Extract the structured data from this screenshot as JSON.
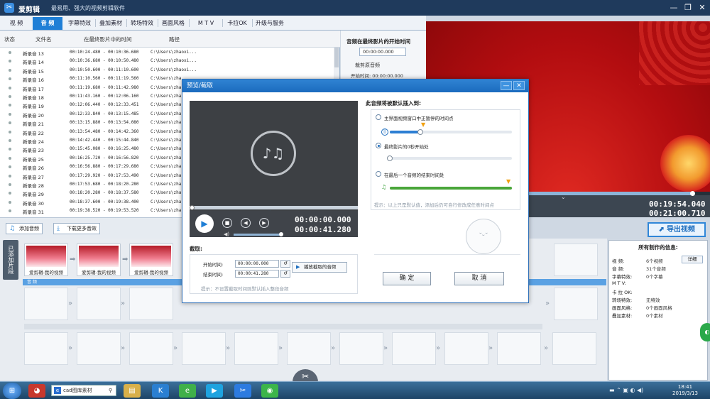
{
  "app": {
    "name": "爱剪辑",
    "slogan": "最易用、强大的视频剪辑软件"
  },
  "window": {
    "minimize": "—",
    "restore": "❐",
    "close": "✕"
  },
  "menu": [
    "视 频",
    "音 频",
    "字幕特效",
    "叠加素材",
    "转场特效",
    "画面风格",
    "M T V",
    "卡拉OK",
    "升级与服务"
  ],
  "table": {
    "headers": [
      "状态",
      "文件名",
      "在最终影片中的时间",
      "路径"
    ],
    "rows": [
      {
        "name": "新录音 13",
        "time": "00:10:24.480 - 00:10:36.680",
        "path": "C:\\Users\\zhaoxi..."
      },
      {
        "name": "新录音 14",
        "time": "00:10:36.680 - 00:10:50.480",
        "path": "C:\\Users\\zhaoxi..."
      },
      {
        "name": "新录音 15",
        "time": "00:10:50.600 - 00:11:10.600",
        "path": "C:\\Users\\zhaoxi..."
      },
      {
        "name": "新录音 16",
        "time": "00:11:10.560 - 00:11:19.560",
        "path": "C:\\Users\\zha"
      },
      {
        "name": "新录音 17",
        "time": "00:11:19.680 - 00:11:42.980",
        "path": "C:\\Users\\zha"
      },
      {
        "name": "新录音 18",
        "time": "00:11:43.160 - 00:12:06.160",
        "path": "C:\\Users\\zha"
      },
      {
        "name": "新录音 19",
        "time": "00:12:06.440 - 00:12:33.451",
        "path": "C:\\Users\\zha"
      },
      {
        "name": "新录音 20",
        "time": "00:12:33.840 - 00:13:15.485",
        "path": "C:\\Users\\zha"
      },
      {
        "name": "新录音 21",
        "time": "00:13:15.880 - 00:13:54.080",
        "path": "C:\\Users\\zha"
      },
      {
        "name": "新录音 22",
        "time": "00:13:54.480 - 00:14:42.360",
        "path": "C:\\Users\\zha"
      },
      {
        "name": "新录音 24",
        "time": "00:14:42.440 - 00:15:44.840",
        "path": "C:\\Users\\zha"
      },
      {
        "name": "新录音 23",
        "time": "00:15:45.080 - 00:16:25.480",
        "path": "C:\\Users\\zha"
      },
      {
        "name": "新录音 25",
        "time": "00:16:25.720 - 00:16:56.820",
        "path": "C:\\Users\\zha"
      },
      {
        "name": "新录音 26",
        "time": "00:16:56.880 - 00:17:29.680",
        "path": "C:\\Users\\zha"
      },
      {
        "name": "新录音 27",
        "time": "00:17:29.920 - 00:17:53.490",
        "path": "C:\\Users\\zha"
      },
      {
        "name": "新录音 28",
        "time": "00:17:53.680 - 00:18:20.280",
        "path": "C:\\Users\\zha"
      },
      {
        "name": "新录音 29",
        "time": "00:18:20.280 - 00:18:37.580",
        "path": "C:\\Users\\zha"
      },
      {
        "name": "新录音 30",
        "time": "00:18:37.600 - 00:19:38.400",
        "path": "C:\\Users\\zha"
      },
      {
        "name": "新录音 31",
        "time": "00:19:38.520 - 00:19:53.520",
        "path": "C:\\Users\\zha"
      }
    ]
  },
  "right_panel": {
    "title": "音频在最终影片的开始时间",
    "start_value": "00:00:00.000",
    "section": "裁剪原音频",
    "start_label": "开始时间:",
    "start_time": "00:00:00.000"
  },
  "preview": {
    "current": "00:19:54.040",
    "total": "00:21:00.710"
  },
  "export_button": "导出视频",
  "toolbar": {
    "add_audio": "添加音频",
    "download_music": "下载更多音效"
  },
  "timeline": {
    "side_label": "已添加片段",
    "clips": [
      "爱剪辑-我的视频",
      "爱剪辑-我的视频",
      "爱剪辑-我的视频"
    ],
    "audio_band": "音 频"
  },
  "info": {
    "title": "所有制作的信息:",
    "detail_button": "详细",
    "lines": [
      {
        "k": "视  频:",
        "v": "6个视频"
      },
      {
        "k": "音  频:",
        "v": "31个音频"
      },
      {
        "k": "字幕特效:",
        "v": "0个字幕"
      },
      {
        "k": "M  T  V:",
        "v": ""
      },
      {
        "k": "卡 拉 OK:",
        "v": ""
      },
      {
        "k": "转场特效:",
        "v": "无特效"
      },
      {
        "k": "画面风格:",
        "v": "0个画面风格"
      },
      {
        "k": "叠加素材:",
        "v": "0个素材"
      }
    ]
  },
  "dialog": {
    "title": "预览/截取",
    "minimize": "—",
    "close": "✕",
    "time_current": "00:00:00.000",
    "time_total": "00:00:41.280",
    "insert_title": "此音频将被默认插入到:",
    "options": [
      {
        "label": "主界面视频窗口中正暂停的时间点",
        "selected": false,
        "fill": 0.25
      },
      {
        "label": "最终影片的0秒开始处",
        "selected": true,
        "fill": 0.0
      },
      {
        "label": "在最后一个音频的结束时间处",
        "selected": false,
        "fill": 1.0
      }
    ],
    "hint": "提示：以上只是默认值，添加后仍可自行修改成任意时间点",
    "cut_title": "截取:",
    "start_label": "开始时间:",
    "start_value": "00:00:00.000",
    "end_label": "结束时间:",
    "end_value": "00:00:41.280",
    "play_cut": "播放截取的音频",
    "cut_hint": "提示：不设置截取时间则默认插入整段音频",
    "confirm": "确 定",
    "cancel": "取 消"
  },
  "taskbar": {
    "search_text": "cad图库素材",
    "time": "18:41",
    "date": "2019/3/13"
  },
  "colors": {
    "accent": "#1f7fd6",
    "title_bg": "#1f3a5c",
    "preview_bg": "#b70f12"
  }
}
